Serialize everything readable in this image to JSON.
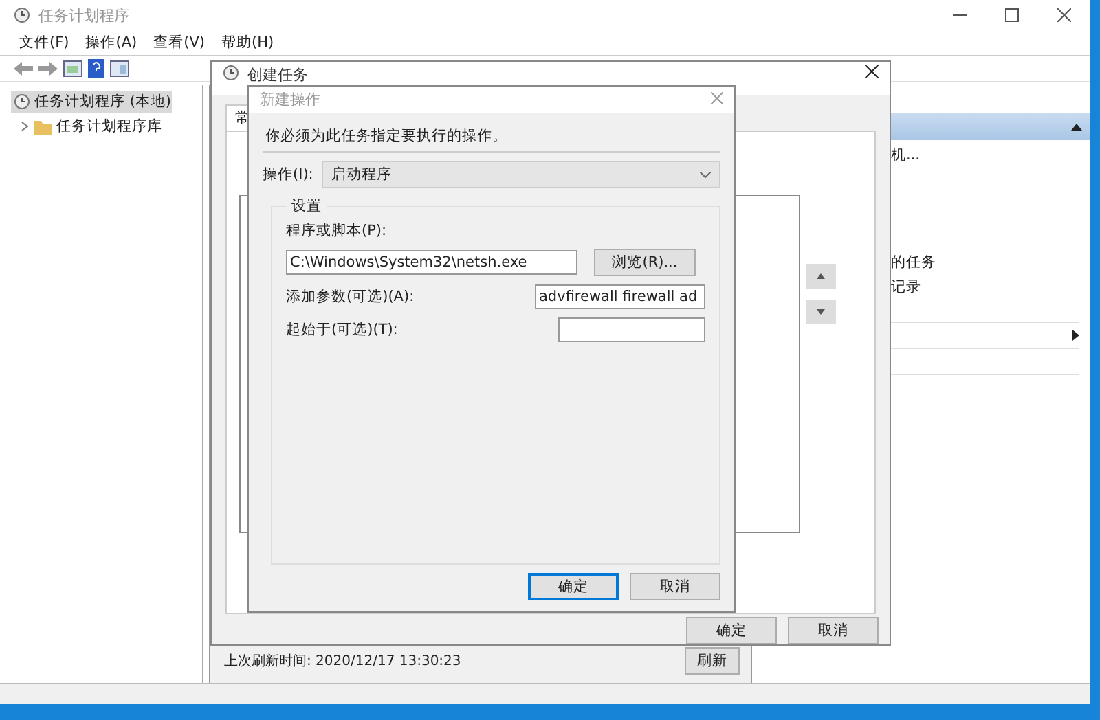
{
  "window": {
    "title": "任务计划程序"
  },
  "menu": [
    "文件(F)",
    "操作(A)",
    "查看(V)",
    "帮助(H)"
  ],
  "tree": [
    {
      "label": "任务计划程序 (本地)",
      "selected": true
    },
    {
      "label": "任务计划程序库",
      "selected": false,
      "expanded": false
    }
  ],
  "actions": [
    "机...",
    "的任务",
    "记录"
  ],
  "status": {
    "text": "上次刷新时间: 2020/12/17 13:30:23",
    "button": "刷新"
  },
  "create_task": {
    "title": "创建任务",
    "tab": "常",
    "buttons": [
      "确定",
      "取消"
    ]
  },
  "new_action": {
    "title": "新建操作",
    "instruction": "你必须为此任务指定要执行的操作。",
    "action_label": "操作(I):",
    "action_value": "启动程序",
    "group": "设置",
    "program_label": "程序或脚本(P):",
    "program_value": "C:\\Windows\\System32\\netsh.exe",
    "browse": "浏览(R)...",
    "args_label": "添加参数(可选)(A):",
    "args_value": "advfirewall firewall ad",
    "start_label": "起始于(可选)(T):",
    "buttons": [
      {
        "label": "确定",
        "default": true
      },
      {
        "label": "取消",
        "default": false
      }
    ]
  }
}
